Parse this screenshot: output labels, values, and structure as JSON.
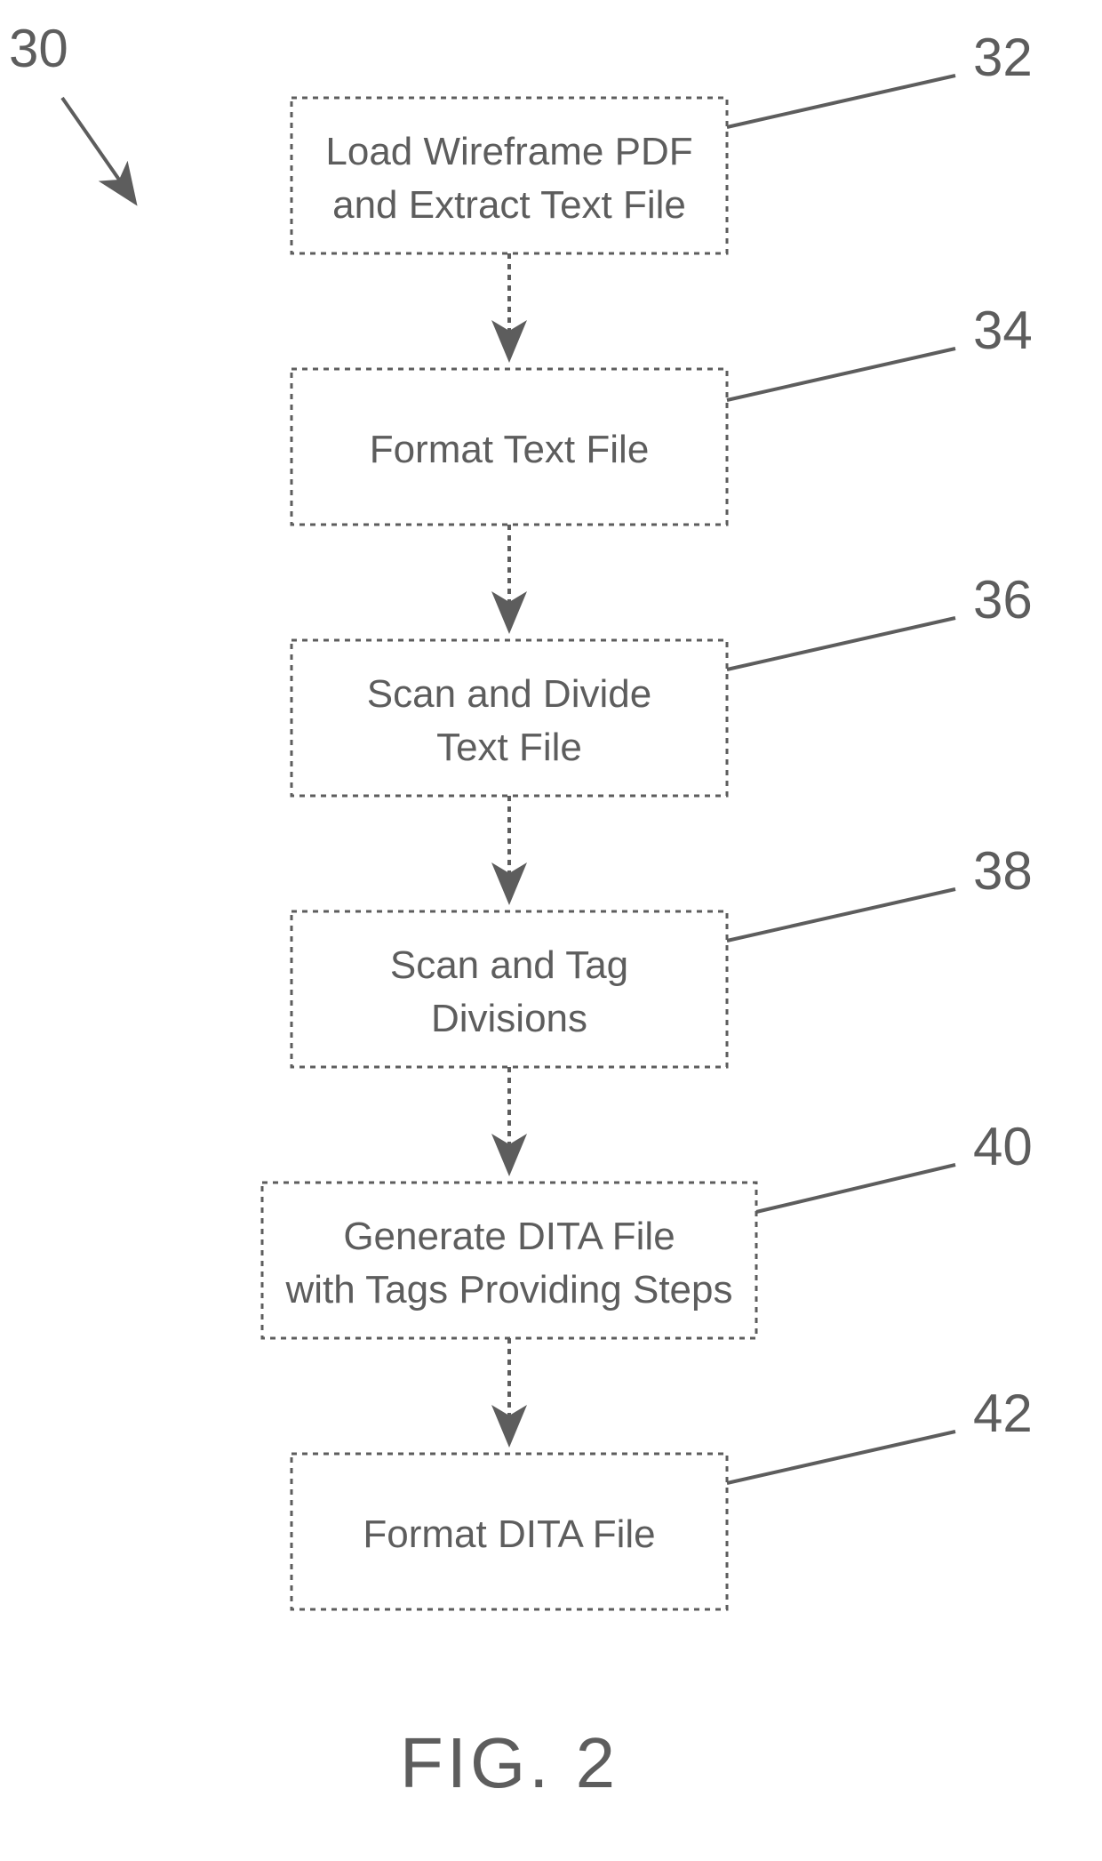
{
  "diagram_ref": "30",
  "figure_label": "FIG. 2",
  "boxes": [
    {
      "ref": "32",
      "lines": [
        "Load Wireframe PDF",
        "and Extract Text File"
      ]
    },
    {
      "ref": "34",
      "lines": [
        "Format Text File"
      ]
    },
    {
      "ref": "36",
      "lines": [
        "Scan and Divide",
        "Text File"
      ]
    },
    {
      "ref": "38",
      "lines": [
        "Scan and Tag",
        "Divisions"
      ]
    },
    {
      "ref": "40",
      "lines": [
        "Generate DITA File",
        "with Tags Providing Steps"
      ]
    },
    {
      "ref": "42",
      "lines": [
        "Format DITA File"
      ]
    }
  ],
  "chart_data": {
    "type": "flowchart",
    "nodes": [
      {
        "id": 32,
        "label": "Load Wireframe PDF and Extract Text File"
      },
      {
        "id": 34,
        "label": "Format Text File"
      },
      {
        "id": 36,
        "label": "Scan and Divide Text File"
      },
      {
        "id": 38,
        "label": "Scan and Tag Divisions"
      },
      {
        "id": 40,
        "label": "Generate DITA File with Tags Providing Steps"
      },
      {
        "id": 42,
        "label": "Format DITA File"
      }
    ],
    "edges": [
      {
        "from": 32,
        "to": 34
      },
      {
        "from": 34,
        "to": 36
      },
      {
        "from": 36,
        "to": 38
      },
      {
        "from": 38,
        "to": 40
      },
      {
        "from": 40,
        "to": 42
      }
    ],
    "title": "FIG. 2",
    "diagram_ref": 30
  }
}
